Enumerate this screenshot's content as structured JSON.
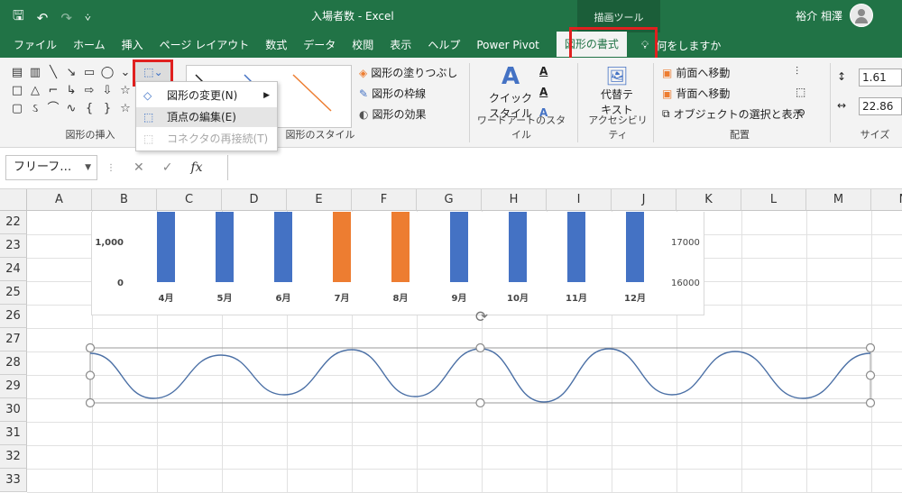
{
  "titlebar": {
    "title": "入場者数  -  Excel",
    "context_tab_group": "描画ツール",
    "user_name": "裕介 相澤",
    "qat": {
      "save": "🖫",
      "undo": "↶",
      "redo": "↷",
      "customize": "⩒"
    }
  },
  "tabs": [
    {
      "label": "ファイル"
    },
    {
      "label": "ホーム"
    },
    {
      "label": "挿入"
    },
    {
      "label": "ページ レイアウト"
    },
    {
      "label": "数式"
    },
    {
      "label": "データ"
    },
    {
      "label": "校閲"
    },
    {
      "label": "表示"
    },
    {
      "label": "ヘルプ"
    },
    {
      "label": "Power Pivot"
    },
    {
      "label": "図形の書式"
    }
  ],
  "tell_me": "何をしますか",
  "ribbon": {
    "insert_shapes_label": "図形の挿入",
    "shape_styles_label": "図形のスタイル",
    "wordart_label": "ワードアートのスタイル",
    "accessibility_label": "アクセシビリティ",
    "arrange_label": "配置",
    "size_label": "サイズ",
    "fill": "図形の塗りつぶし",
    "outline": "図形の枠線",
    "effects": "図形の効果",
    "quick_style": "クイック\nスタイル",
    "quick_style_1": "クイック",
    "quick_style_2": "スタイル",
    "alt_text_1": "代替テ",
    "alt_text_2": "キスト",
    "bring_forward": "前面へ移動",
    "send_backward": "背面へ移動",
    "selection_pane": "オブジェクトの選択と表示",
    "height": "1.61 cm",
    "width": "22.86 cm"
  },
  "menu": {
    "change_shape": "図形の変更(N)",
    "edit_points": "頂点の編集(E)",
    "reroute": "コネクタの再接続(T)"
  },
  "formula_bar": {
    "name_box": "フリーフ…",
    "cancel": "✕",
    "enter": "✓",
    "fx": "fx"
  },
  "columns": [
    "A",
    "B",
    "C",
    "D",
    "E",
    "F",
    "G",
    "H",
    "I",
    "J",
    "K",
    "L",
    "M",
    "N"
  ],
  "rows": [
    "22",
    "23",
    "24",
    "25",
    "26",
    "27",
    "28",
    "29",
    "30",
    "31",
    "32",
    "33"
  ],
  "chart_data": {
    "type": "bar",
    "categories": [
      "4月",
      "5月",
      "6月",
      "7月",
      "8月",
      "9月",
      "10月",
      "11月",
      "12月"
    ],
    "bar_colors": [
      "#4472c4",
      "#4472c4",
      "#4472c4",
      "#ed7d31",
      "#ed7d31",
      "#4472c4",
      "#4472c4",
      "#4472c4",
      "#4472c4"
    ],
    "left_axis_ticks": [
      "1,000",
      "0"
    ],
    "right_axis_ticks": [
      "17000",
      "16000"
    ]
  },
  "colors": {
    "excel_green": "#217346",
    "highlight_red": "#e0201f",
    "wave_line": "#4a6fa5"
  }
}
